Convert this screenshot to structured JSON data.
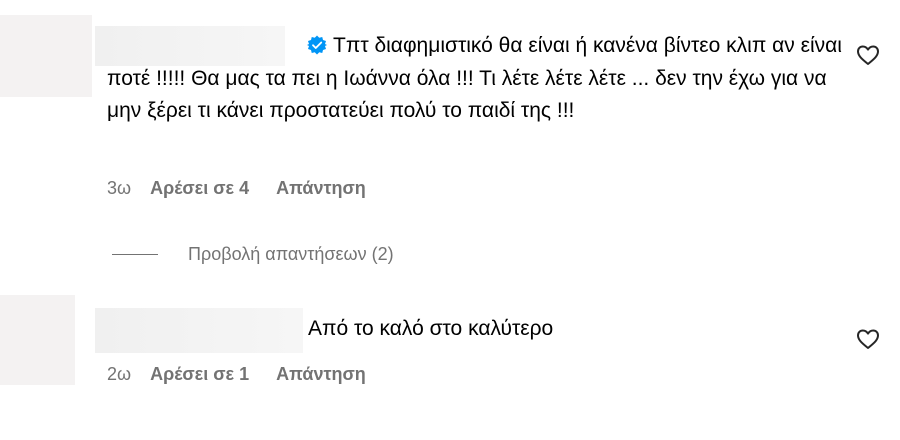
{
  "comments": [
    {
      "text": "Τπτ διαφημιστικό θα είναι ή κανένα βίντεο κλιπ αν είναι ποτέ !!!!! Θα μας τα πει η Ιωάννα όλα !!! Τι λέτε λέτε λέτε ... δεν την έχω για να μην ξέρει τι κάνει προστατεύει πολύ το παιδί της !!!",
      "verified": true,
      "time": "3ω",
      "likes": "Αρέσει σε 4",
      "reply_label": "Απάντηση",
      "view_replies": "Προβολή απαντήσεων (2)"
    },
    {
      "text": "Από το καλό στο καλύτερο",
      "verified": false,
      "time": "2ω",
      "likes": "Αρέσει σε 1",
      "reply_label": "Απάντηση"
    }
  ],
  "colors": {
    "verified_badge": "#0095f6",
    "meta_text": "#737373",
    "redacted": "#f2f0f0"
  },
  "icons": {
    "verified": "verified-badge-icon",
    "like": "heart-outline-icon"
  }
}
